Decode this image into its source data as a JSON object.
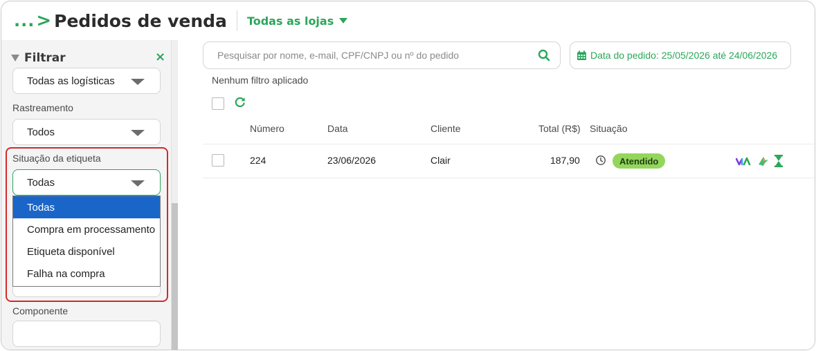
{
  "header": {
    "breadcrumb_ellipsis": "...",
    "breadcrumb_separator": ">",
    "title": "Pedidos de venda",
    "store_selector": "Todas as lojas"
  },
  "sidebar": {
    "filter_title": "Filtrar",
    "close_icon": "×",
    "logistics_value": "Todas as logísticas",
    "tracking_label": "Rastreamento",
    "tracking_value": "Todos",
    "label_status_label": "Situação da etiqueta",
    "label_status_value": "Todas",
    "label_status_options": [
      "Todas",
      "Compra em processamento",
      "Etiqueta disponível",
      "Falha na compra"
    ],
    "component_label": "Componente",
    "component_value": ""
  },
  "main": {
    "search_placeholder": "Pesquisar por nome, e-mail, CPF/CNPJ ou nº do pedido",
    "date_filter": "Data do pedido: 25/05/2026 até 24/06/2026",
    "no_filter_text": "Nenhum filtro aplicado",
    "columns": {
      "numero": "Número",
      "data": "Data",
      "cliente": "Cliente",
      "total": "Total (R$)",
      "situacao": "Situação"
    },
    "rows": [
      {
        "numero": "224",
        "data": "23/06/2026",
        "cliente": "Clair",
        "total": "187,90",
        "situacao": "Atendido"
      }
    ]
  },
  "colors": {
    "accent": "#2aa65a",
    "status_badge": "#94d65c",
    "selected_option": "#1a66c8",
    "highlight": "#d12a2a"
  },
  "icons": [
    "search-icon",
    "calendar-icon",
    "refresh-icon",
    "clock-icon",
    "filter-icon",
    "close-icon",
    "integration-icon",
    "bird-icon",
    "hourglass-icon"
  ]
}
